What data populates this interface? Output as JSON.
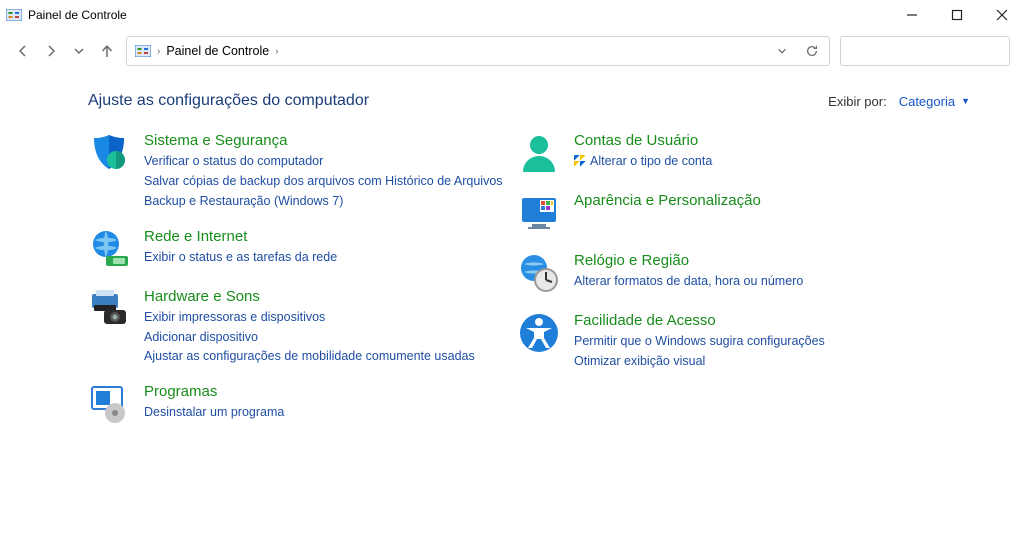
{
  "window": {
    "title": "Painel de Controle"
  },
  "breadcrumb": {
    "text": "Painel de Controle"
  },
  "search": {
    "value": "",
    "placeholder": ""
  },
  "page": {
    "title": "Ajuste as configurações do computador",
    "viewby_label": "Exibir por:",
    "viewby_value": "Categoria"
  },
  "left": {
    "c0": {
      "heading": "Sistema e Segurança",
      "l0": "Verificar o status do computador",
      "l1": "Salvar cópias de backup dos arquivos com Histórico de Arquivos",
      "l2": "Backup e Restauração (Windows 7)"
    },
    "c1": {
      "heading": "Rede e Internet",
      "l0": "Exibir o status e as tarefas da rede"
    },
    "c2": {
      "heading": "Hardware e Sons",
      "l0": "Exibir impressoras e dispositivos",
      "l1": "Adicionar dispositivo",
      "l2": "Ajustar as configurações de mobilidade comumente usadas"
    },
    "c3": {
      "heading": "Programas",
      "l0": "Desinstalar um programa"
    }
  },
  "right": {
    "c0": {
      "heading": "Contas de Usuário",
      "l0": "Alterar o tipo de conta"
    },
    "c1": {
      "heading": "Aparência e Personalização"
    },
    "c2": {
      "heading": "Relógio e Região",
      "l0": "Alterar formatos de data, hora ou número"
    },
    "c3": {
      "heading": "Facilidade de Acesso",
      "l0": "Permitir que o Windows sugira configurações",
      "l1": "Otimizar exibição visual"
    }
  }
}
